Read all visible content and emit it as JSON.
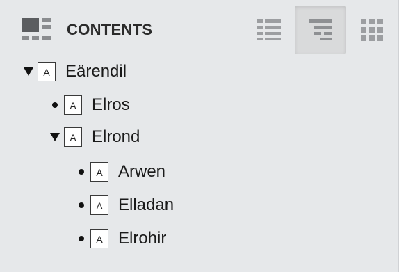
{
  "header": {
    "title": "CONTENTS",
    "icon": "contents-panel-icon"
  },
  "view_buttons": [
    {
      "name": "list-view-icon",
      "selected": false
    },
    {
      "name": "outline-view-icon",
      "selected": true
    },
    {
      "name": "grid-view-icon",
      "selected": false
    }
  ],
  "tree": {
    "items": [
      {
        "label": "Eärendil",
        "expanded": true,
        "icon_letter": "A"
      },
      {
        "label": "Elros",
        "icon_letter": "A"
      },
      {
        "label": "Elrond",
        "expanded": true,
        "icon_letter": "A"
      },
      {
        "label": "Arwen",
        "icon_letter": "A"
      },
      {
        "label": "Elladan",
        "icon_letter": "A"
      },
      {
        "label": "Elrohir",
        "icon_letter": "A"
      }
    ]
  },
  "colors": {
    "panel_background": "#e6e8ea",
    "selected_button_background": "#d9dadb",
    "text": "#1a1a1a"
  }
}
